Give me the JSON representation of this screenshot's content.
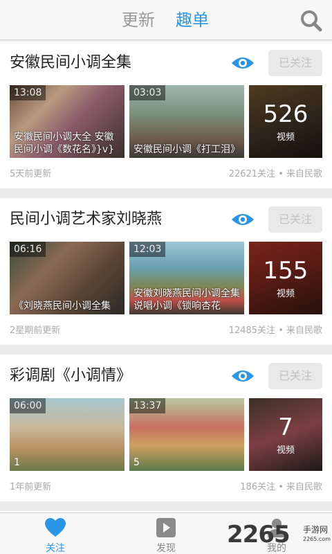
{
  "header": {
    "tab_update": "更新",
    "tab_playlist": "趣单",
    "search_icon": "search-icon"
  },
  "cards": [
    {
      "title": "安徽民间小调全集",
      "follow": "已关注",
      "thumbs": [
        {
          "duration": "13:08",
          "caption": "安徽民间小调大全 安徽民间小调《数花名》}v}"
        },
        {
          "duration": "03:03",
          "caption": "安徽民间小调《打工泪》"
        }
      ],
      "count": "526",
      "count_label": "视频",
      "updated": "5天前更新",
      "stats": "22621关注 • 来自民歌"
    },
    {
      "title": "民间小调艺术家刘晓燕",
      "follow": "已关注",
      "thumbs": [
        {
          "duration": "06:16",
          "caption": "《刘晓燕民间小调全集"
        },
        {
          "duration": "12:03",
          "caption": "安徽刘晓燕民间小调全集 说唱小调《锁响杏花"
        }
      ],
      "count": "155",
      "count_label": "视频",
      "updated": "2星期前更新",
      "stats": "12485关注 • 来自民歌"
    },
    {
      "title": "彩调剧《小调情》",
      "follow": "已关注",
      "thumbs": [
        {
          "duration": "06:00",
          "index": "1"
        },
        {
          "duration": "13:37",
          "index": "5"
        }
      ],
      "count": "7",
      "count_label": "视频",
      "updated": "1年前更新",
      "stats": "186关注 • 来自民歌"
    }
  ],
  "nav": {
    "follow": "关注",
    "discover": "发现",
    "mine": "我的"
  },
  "watermark": {
    "brand": "2265",
    "site": "手游网",
    "domain": "2265.com"
  },
  "colors": {
    "accent": "#2b95e8",
    "follow_bg": "#e9e9e9"
  }
}
